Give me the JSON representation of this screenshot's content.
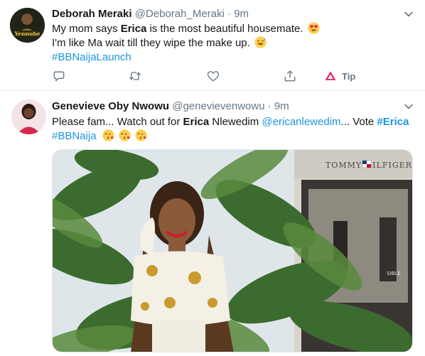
{
  "tweet1": {
    "name": "Deborah Meraki",
    "handle": "@Deborah_Meraki",
    "dot": "·",
    "time": "9m",
    "avatar_text": "Yennube",
    "line1_pre": "My mom says ",
    "line1_bold": "Erica",
    "line1_post": " is the most beautiful housemate.",
    "line1_emoji": "heart-eyes-emoji",
    "line2": "I'm like Ma wait till they wipe the make up.",
    "line2_emoji": "sweat-smile-emoji",
    "hashtag": "#BBNaijaLaunch",
    "tip_label": "Tip"
  },
  "tweet2": {
    "name": "Genevieve Oby Nwowu",
    "handle": "@genevievenwowu",
    "dot": "·",
    "time": "9m",
    "line1_pre": "Please fam... Watch out for ",
    "line1_bold": "Erica",
    "line1_mid": " Nlewedim ",
    "line1_mention": "@ericanlewedim",
    "line1_post": "... Vote ",
    "line1_hash": "#Erica",
    "hashtag": "#BBNaija",
    "emojis": [
      "kiss-emoji",
      "kiss-emoji",
      "kiss-emoji"
    ],
    "photo_sign": "TOMMY HILFIGER",
    "photo_side_text": "SIBLE"
  },
  "colors": {
    "link": "#1b95e0",
    "muted": "#657786",
    "tip_accent": "#e0245e"
  }
}
